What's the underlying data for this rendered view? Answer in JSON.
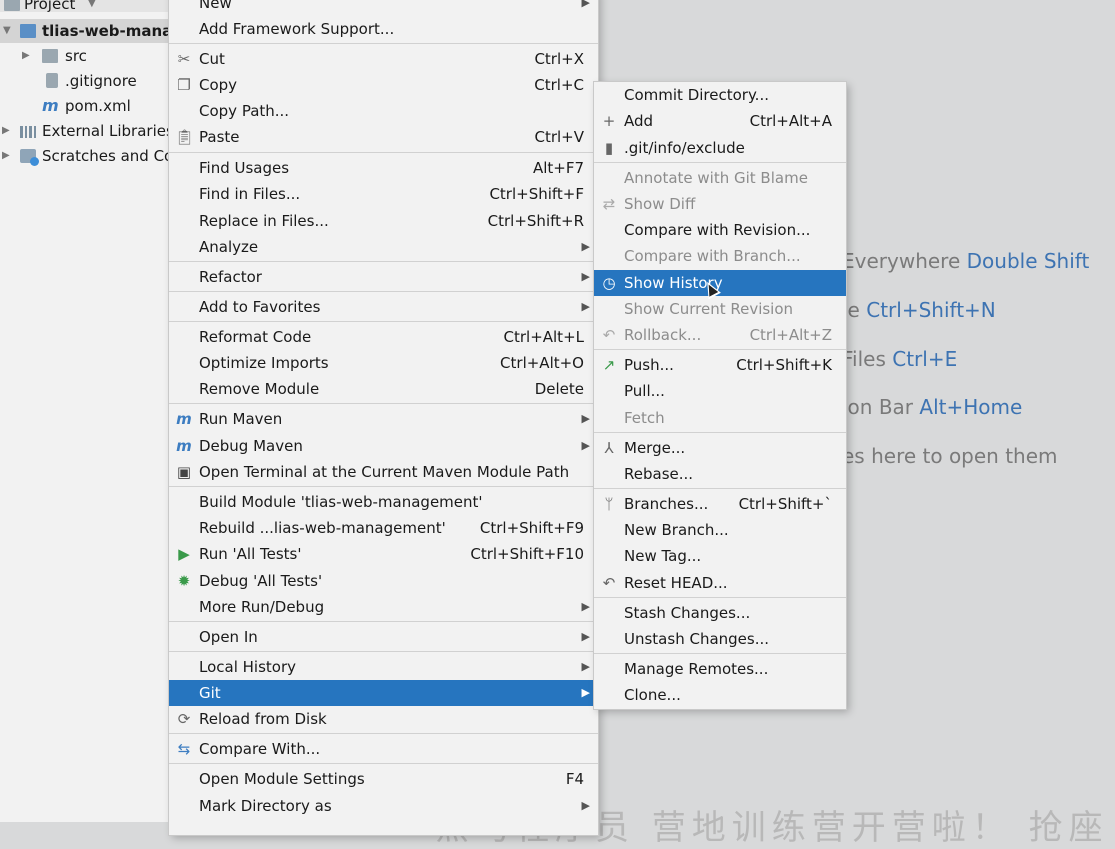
{
  "tree": {
    "header": "Project",
    "root": "tlias-web-manag",
    "items": [
      {
        "label": "src",
        "icon": "folder-icon"
      },
      {
        "label": ".gitignore",
        "icon": "git-file-icon"
      },
      {
        "label": "pom.xml",
        "icon": "maven-file-icon"
      },
      {
        "label": "External Libraries",
        "icon": "libraries-icon"
      },
      {
        "label": "Scratches and Co",
        "icon": "scratches-icon"
      }
    ]
  },
  "hints": [
    {
      "text": "Everywhere",
      "key": "Double Shift"
    },
    {
      "text": "le",
      "key": "Ctrl+Shift+N"
    },
    {
      "text": "Files",
      "key": "Ctrl+E"
    },
    {
      "text": "ion Bar",
      "key": "Alt+Home"
    },
    {
      "text": "es here to open them",
      "key": ""
    }
  ],
  "watermark": "黑马程序员 营地训练营开营啦！ 抢座",
  "context_menu": {
    "top_partial": "New",
    "items": {
      "add_framework": "Add Framework Support...",
      "cut": "Cut",
      "cut_sc": "Ctrl+X",
      "copy": "Copy",
      "copy_sc": "Ctrl+C",
      "copy_path": "Copy Path...",
      "paste": "Paste",
      "paste_sc": "Ctrl+V",
      "find_usages": "Find Usages",
      "find_usages_sc": "Alt+F7",
      "find_in_files": "Find in Files...",
      "find_in_files_sc": "Ctrl+Shift+F",
      "replace_in_files": "Replace in Files...",
      "replace_in_files_sc": "Ctrl+Shift+R",
      "analyze": "Analyze",
      "refactor": "Refactor",
      "add_to_favorites": "Add to Favorites",
      "reformat_code": "Reformat Code",
      "reformat_code_sc": "Ctrl+Alt+L",
      "optimize_imports": "Optimize Imports",
      "optimize_imports_sc": "Ctrl+Alt+O",
      "remove_module": "Remove Module",
      "remove_module_sc": "Delete",
      "run_maven": "Run Maven",
      "debug_maven": "Debug Maven",
      "open_terminal": "Open Terminal at the Current Maven Module Path",
      "build_module": "Build Module 'tlias-web-management'",
      "rebuild": "Rebuild ...lias-web-management'",
      "rebuild_sc": "Ctrl+Shift+F9",
      "run_tests": "Run 'All Tests'",
      "run_tests_sc": "Ctrl+Shift+F10",
      "debug_tests": "Debug 'All Tests'",
      "more_run": "More Run/Debug",
      "open_in": "Open In",
      "local_history": "Local History",
      "git": "Git",
      "reload": "Reload from Disk",
      "compare_with": "Compare With...",
      "module_settings": "Open Module Settings",
      "module_settings_sc": "F4",
      "mark_directory": "Mark Directory as"
    }
  },
  "git_menu": {
    "commit_directory": "Commit Directory...",
    "add": "Add",
    "add_sc": "Ctrl+Alt+A",
    "exclude": ".git/info/exclude",
    "annotate": "Annotate with Git Blame",
    "show_diff": "Show Diff",
    "compare_revision": "Compare with Revision...",
    "compare_branch": "Compare with Branch...",
    "show_history": "Show History",
    "show_current_revision": "Show Current Revision",
    "rollback": "Rollback...",
    "rollback_sc": "Ctrl+Alt+Z",
    "push": "Push...",
    "push_sc": "Ctrl+Shift+K",
    "pull": "Pull...",
    "fetch": "Fetch",
    "merge": "Merge...",
    "rebase": "Rebase...",
    "branches": "Branches...",
    "branches_sc": "Ctrl+Shift+`",
    "new_branch": "New Branch...",
    "new_tag": "New Tag...",
    "reset_head": "Reset HEAD...",
    "stash": "Stash Changes...",
    "unstash": "Unstash Changes...",
    "manage_remotes": "Manage Remotes...",
    "clone": "Clone..."
  },
  "colors": {
    "selection": "#2675bf",
    "menu_bg": "#f2f2f2",
    "hint_key": "#3d73b2"
  }
}
